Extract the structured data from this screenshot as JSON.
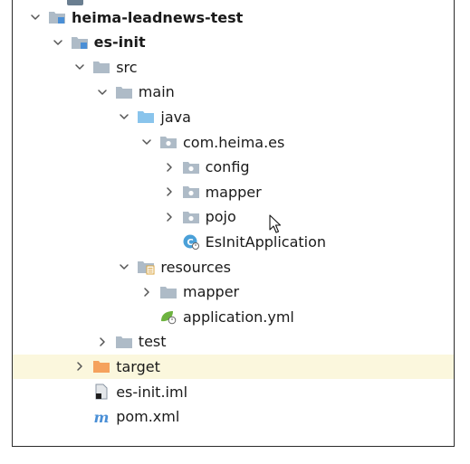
{
  "project_tree": {
    "nodes": [
      {
        "label": "heima-leadnews-test",
        "depth": 0,
        "expanded": true,
        "icon": "module-folder-icon",
        "bold": true
      },
      {
        "label": "es-init",
        "depth": 1,
        "expanded": true,
        "icon": "module-folder-icon",
        "bold": true
      },
      {
        "label": "src",
        "depth": 2,
        "expanded": true,
        "icon": "folder-icon"
      },
      {
        "label": "main",
        "depth": 3,
        "expanded": true,
        "icon": "folder-icon"
      },
      {
        "label": "java",
        "depth": 4,
        "expanded": true,
        "icon": "source-root-folder-icon"
      },
      {
        "label": "com.heima.es",
        "depth": 5,
        "expanded": true,
        "icon": "package-icon"
      },
      {
        "label": "config",
        "depth": 6,
        "expanded": false,
        "icon": "package-icon"
      },
      {
        "label": "mapper",
        "depth": 6,
        "expanded": false,
        "icon": "package-icon"
      },
      {
        "label": "pojo",
        "depth": 6,
        "expanded": false,
        "icon": "package-icon"
      },
      {
        "label": "EsInitApplication",
        "depth": 6,
        "expanded": null,
        "icon": "spring-boot-class-icon"
      },
      {
        "label": "resources",
        "depth": 4,
        "expanded": true,
        "icon": "resources-folder-icon"
      },
      {
        "label": "mapper",
        "depth": 5,
        "expanded": false,
        "icon": "folder-icon"
      },
      {
        "label": "application.yml",
        "depth": 5,
        "expanded": null,
        "icon": "spring-config-icon"
      },
      {
        "label": "test",
        "depth": 3,
        "expanded": false,
        "icon": "folder-icon"
      },
      {
        "label": "target",
        "depth": 2,
        "expanded": false,
        "icon": "excluded-folder-icon",
        "highlighted": true
      },
      {
        "label": "es-init.iml",
        "depth": 2,
        "expanded": null,
        "icon": "iml-file-icon"
      },
      {
        "label": "pom.xml",
        "depth": 2,
        "expanded": null,
        "icon": "maven-pom-icon"
      }
    ]
  },
  "colors": {
    "folder": "#aebbc7",
    "source_root": "#89c4ec",
    "excluded": "#f5a25d",
    "highlight_row": "#fbf7dd",
    "chevron": "#555555",
    "maven": "#4a8fd6",
    "spring": "#6db33f"
  }
}
